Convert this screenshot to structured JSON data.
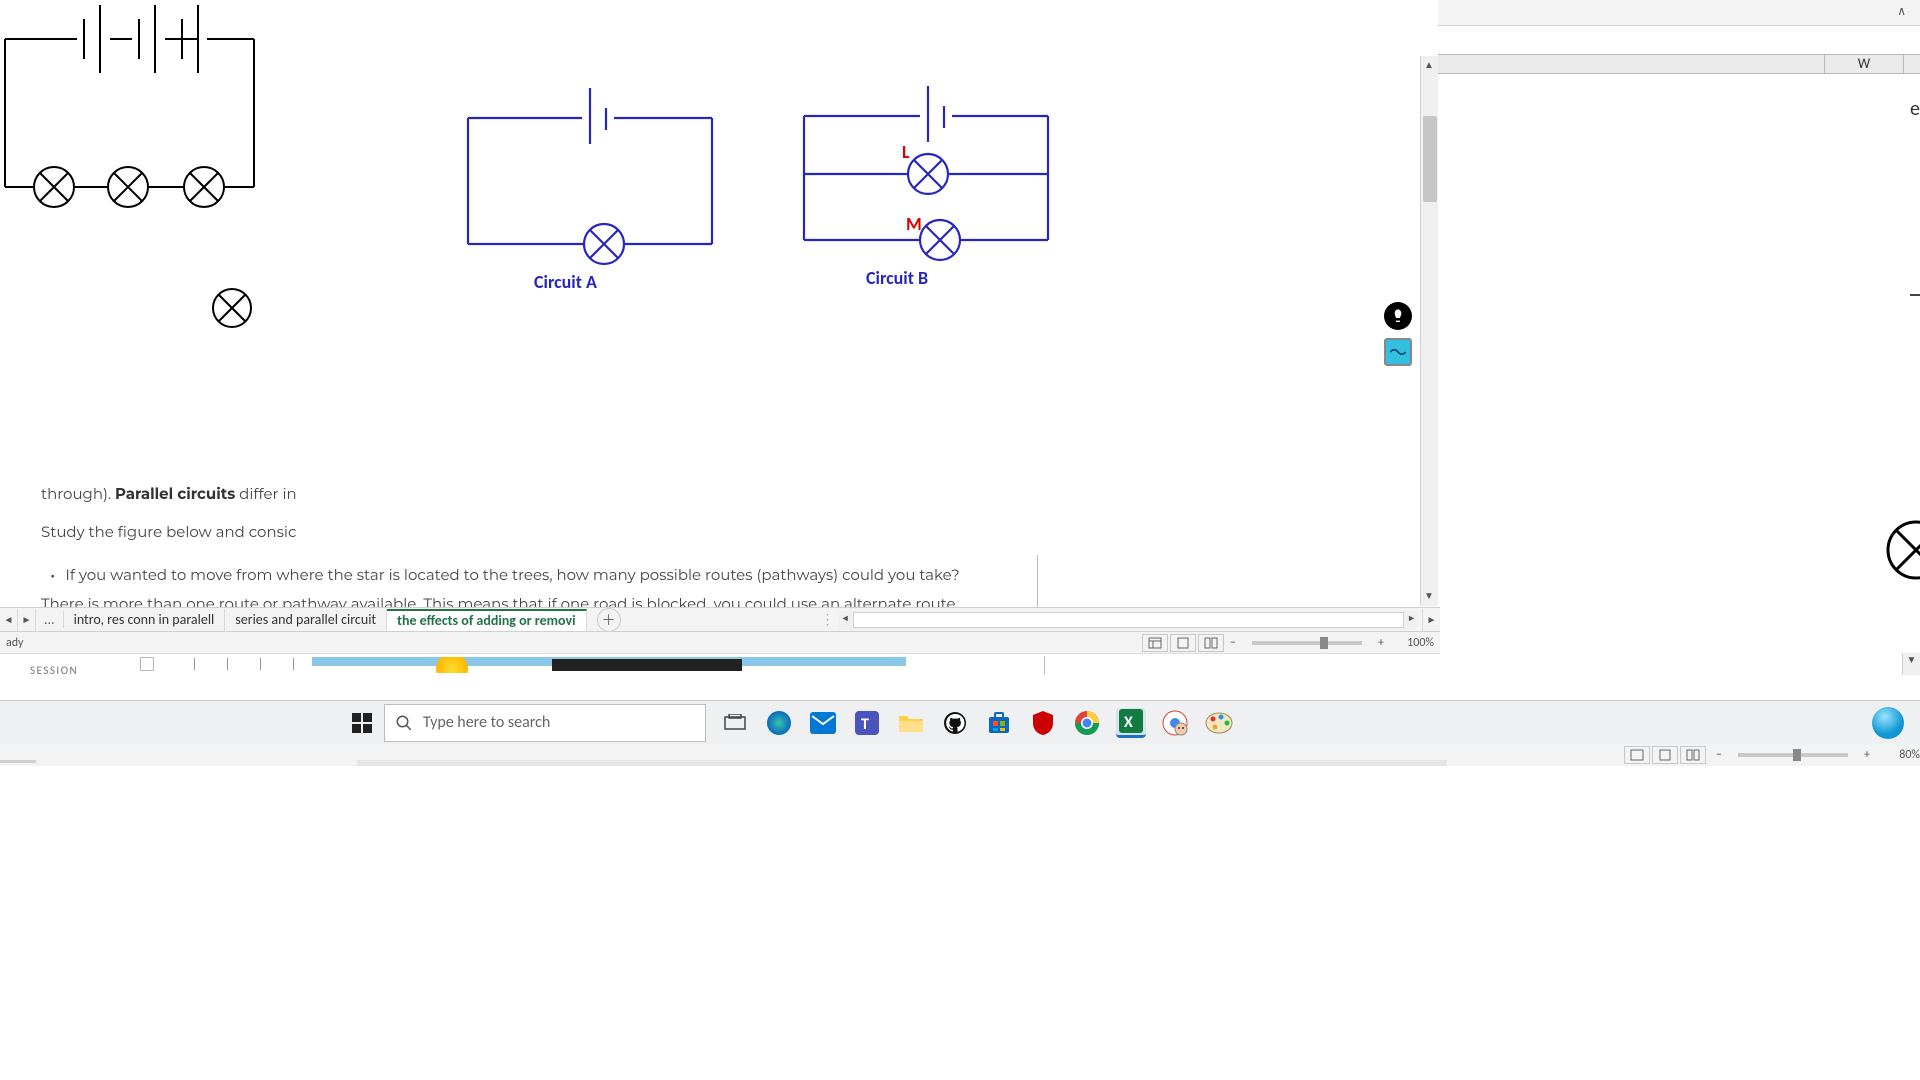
{
  "excel_fragment": {
    "column_letter": "W",
    "cell_text": "e"
  },
  "circuits": {
    "a_label": "Circuit A",
    "b_label": "Circuit B",
    "b_bulb_L": "L",
    "b_bulb_M": "M"
  },
  "doc": {
    "line1_pre": "through). ",
    "line1_strong": "Parallel circuits",
    "line1_post": " differ in ",
    "line2": "Study the figure below and consic",
    "bullet1": "If you wanted to move from where the star is located to the trees, how many possible routes (pathways) could you take?",
    "line3": "There is more than one route or pathway available. This means that if one road is blocked, you could use an alternate route"
  },
  "sheet_tabs": {
    "t1": "intro, res conn in paralell",
    "t2": "series and parallel circuit",
    "t3": "the effects of adding or removi",
    "ellipsis": "...",
    "plus": "＋"
  },
  "status": {
    "ready": "ady",
    "zoom_100": "100%",
    "zoom_80": "80%",
    "minus": "−",
    "plus": "+"
  },
  "session_label": "SESSION",
  "taskbar": {
    "search_placeholder": "Type here to search"
  }
}
